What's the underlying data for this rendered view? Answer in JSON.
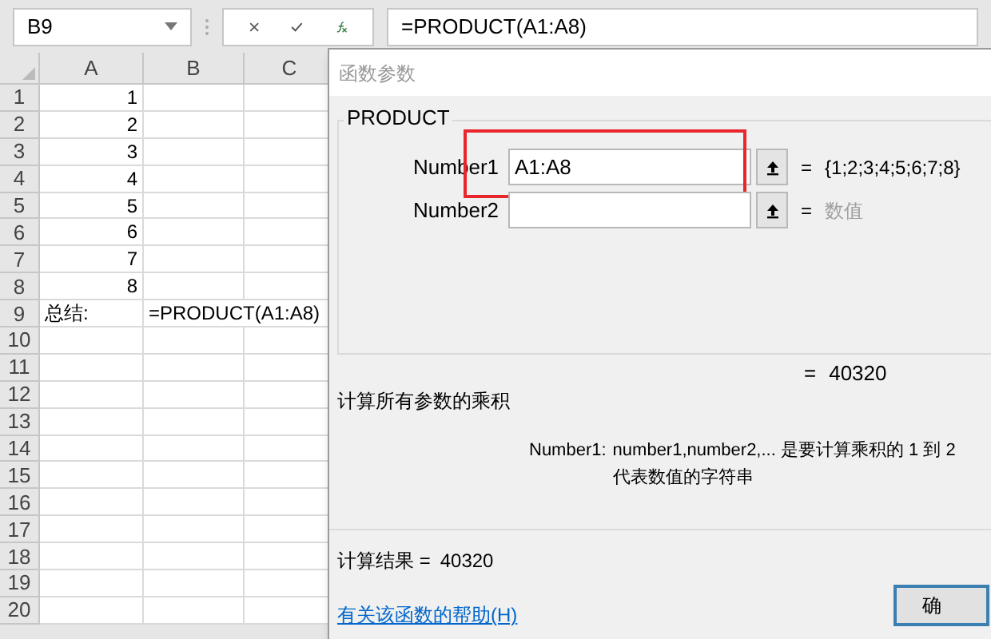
{
  "formula_bar": {
    "name_box": "B9",
    "formula": "=PRODUCT(A1:A8)"
  },
  "sheet": {
    "columns": [
      "A",
      "B",
      "C"
    ],
    "rows": [
      {
        "header": "1",
        "cells": [
          {
            "kind": "number",
            "text": "1"
          },
          {
            "kind": "empty"
          },
          {
            "kind": "empty"
          }
        ]
      },
      {
        "header": "2",
        "cells": [
          {
            "kind": "number",
            "text": "2"
          },
          {
            "kind": "empty"
          },
          {
            "kind": "empty"
          }
        ]
      },
      {
        "header": "3",
        "cells": [
          {
            "kind": "number",
            "text": "3"
          },
          {
            "kind": "empty"
          },
          {
            "kind": "empty"
          }
        ]
      },
      {
        "header": "4",
        "cells": [
          {
            "kind": "number",
            "text": "4"
          },
          {
            "kind": "empty"
          },
          {
            "kind": "empty"
          }
        ]
      },
      {
        "header": "5",
        "cells": [
          {
            "kind": "number",
            "text": "5"
          },
          {
            "kind": "empty"
          },
          {
            "kind": "empty"
          }
        ]
      },
      {
        "header": "6",
        "cells": [
          {
            "kind": "number",
            "text": "6"
          },
          {
            "kind": "empty"
          },
          {
            "kind": "empty"
          }
        ]
      },
      {
        "header": "7",
        "cells": [
          {
            "kind": "number",
            "text": "7"
          },
          {
            "kind": "empty"
          },
          {
            "kind": "empty"
          }
        ]
      },
      {
        "header": "8",
        "cells": [
          {
            "kind": "number",
            "text": "8"
          },
          {
            "kind": "empty"
          },
          {
            "kind": "empty"
          }
        ]
      },
      {
        "header": "9",
        "cells": [
          {
            "kind": "text",
            "text": "总结:"
          },
          {
            "kind": "text",
            "text": "=PRODUCT(A1:A8)"
          },
          {
            "kind": "empty"
          }
        ]
      },
      {
        "header": "10",
        "cells": [
          {
            "kind": "empty"
          },
          {
            "kind": "empty"
          },
          {
            "kind": "empty"
          }
        ]
      },
      {
        "header": "11",
        "cells": [
          {
            "kind": "empty"
          },
          {
            "kind": "empty"
          },
          {
            "kind": "empty"
          }
        ]
      },
      {
        "header": "12",
        "cells": [
          {
            "kind": "empty"
          },
          {
            "kind": "empty"
          },
          {
            "kind": "empty"
          }
        ]
      },
      {
        "header": "13",
        "cells": [
          {
            "kind": "empty"
          },
          {
            "kind": "empty"
          },
          {
            "kind": "empty"
          }
        ]
      },
      {
        "header": "14",
        "cells": [
          {
            "kind": "empty"
          },
          {
            "kind": "empty"
          },
          {
            "kind": "empty"
          }
        ]
      },
      {
        "header": "15",
        "cells": [
          {
            "kind": "empty"
          },
          {
            "kind": "empty"
          },
          {
            "kind": "empty"
          }
        ]
      },
      {
        "header": "16",
        "cells": [
          {
            "kind": "empty"
          },
          {
            "kind": "empty"
          },
          {
            "kind": "empty"
          }
        ]
      },
      {
        "header": "17",
        "cells": [
          {
            "kind": "empty"
          },
          {
            "kind": "empty"
          },
          {
            "kind": "empty"
          }
        ]
      },
      {
        "header": "18",
        "cells": [
          {
            "kind": "empty"
          },
          {
            "kind": "empty"
          },
          {
            "kind": "empty"
          }
        ]
      },
      {
        "header": "19",
        "cells": [
          {
            "kind": "empty"
          },
          {
            "kind": "empty"
          },
          {
            "kind": "empty"
          }
        ]
      },
      {
        "header": "20",
        "cells": [
          {
            "kind": "empty"
          },
          {
            "kind": "empty"
          },
          {
            "kind": "empty"
          }
        ]
      }
    ]
  },
  "dialog": {
    "title": "函数参数",
    "function_name": "PRODUCT",
    "arguments": [
      {
        "label": "Number1",
        "value": "A1:A8",
        "sign": "=",
        "result": "{1;2;3;4;5;6;7;8}",
        "result_muted": false,
        "highlighted": true
      },
      {
        "label": "Number2",
        "sign": "=",
        "result": "数值",
        "result_muted": true,
        "highlighted": false
      }
    ],
    "formula_result_sign": "=",
    "formula_result": "40320",
    "description": "计算所有参数的乘积",
    "argument_help_label": "Number1:",
    "argument_help_lines": [
      "number1,number2,... 是要计算乘积的 1 到 2",
      "代表数值的字符串"
    ],
    "calc_result_label": "计算结果 =",
    "calc_result": "40320",
    "help_link": "有关该函数的帮助(H)",
    "ok_button": "确"
  }
}
